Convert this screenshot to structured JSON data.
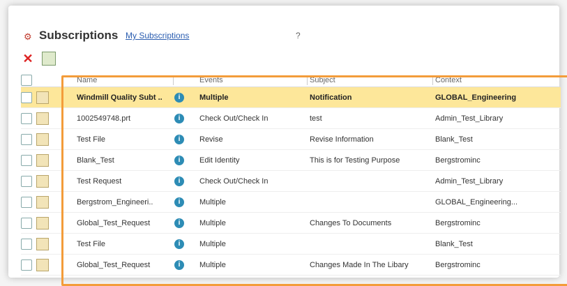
{
  "header": {
    "title": "Subscriptions",
    "subtitle": "My Subscriptions",
    "help_icon": "help-icon",
    "title_icon": "subscription-icon"
  },
  "toolbar": {
    "delete_icon": "delete-icon",
    "action_icon": "add-subscription-icon"
  },
  "table": {
    "columns": [
      "Name",
      "Events",
      "Subject",
      "Context"
    ],
    "rows": [
      {
        "name": "Windmill Quality Subt ..",
        "events": "Multiple",
        "subject": "Notification",
        "context": "GLOBAL_Engineering",
        "selected": true
      },
      {
        "name": "1002549748.prt",
        "events": "Check Out/Check In",
        "subject": "test",
        "context": "Admin_Test_Library",
        "selected": false
      },
      {
        "name": "Test File",
        "events": "Revise",
        "subject": "Revise Information",
        "context": "Blank_Test",
        "selected": false
      },
      {
        "name": "Blank_Test",
        "events": "Edit Identity",
        "subject": "This is for Testing Purpose",
        "context": "Bergstrominc",
        "selected": false
      },
      {
        "name": "Test Request",
        "events": "Check Out/Check In",
        "subject": "",
        "context": "Admin_Test_Library",
        "selected": false
      },
      {
        "name": "Bergstrom_Engineeri..",
        "events": "Multiple",
        "subject": "",
        "context": "GLOBAL_Engineering...",
        "selected": false
      },
      {
        "name": "Global_Test_Request",
        "events": "Multiple",
        "subject": "Changes To Documents",
        "context": "Bergstrominc",
        "selected": false
      },
      {
        "name": "Test File",
        "events": "Multiple",
        "subject": "",
        "context": "Blank_Test",
        "selected": false
      },
      {
        "name": "Global_Test_Request",
        "events": "Multiple",
        "subject": "Changes Made In The Libary",
        "context": "Bergstrominc",
        "selected": false
      }
    ]
  },
  "colors": {
    "highlight_border": "#f39c3a",
    "selected_row": "#fde79a"
  }
}
